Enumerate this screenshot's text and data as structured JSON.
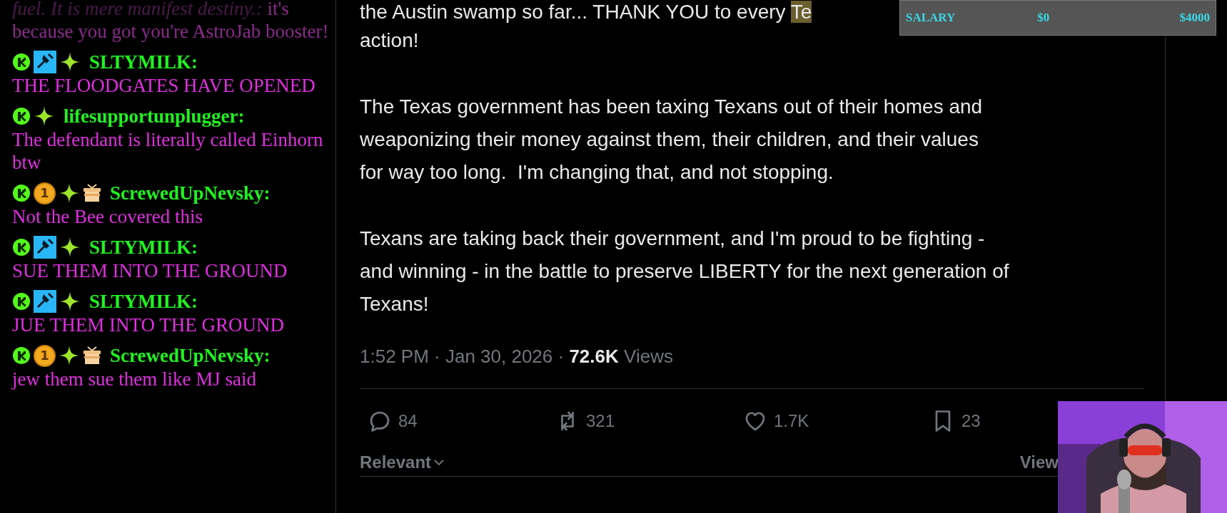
{
  "chat": {
    "messages": [
      {
        "faded": true,
        "prefix": "fuel. It is mere manifest destiny.:",
        "text": "it's because you got you're AstroJab booster!"
      },
      {
        "faded": false,
        "badges": [
          {
            "kind": "kick"
          },
          {
            "kind": "mod"
          },
          {
            "kind": "sparkle"
          }
        ],
        "user": "SLTYMILK:",
        "text": "THE FLOODGATES HAVE OPENED"
      },
      {
        "faded": false,
        "badges": [
          {
            "kind": "kick"
          },
          {
            "kind": "sparkle"
          }
        ],
        "user": "lifesupportunplugger:",
        "text": "The defendant is literally called Einhorn btw"
      },
      {
        "faded": false,
        "badges": [
          {
            "kind": "kick"
          },
          {
            "kind": "coin",
            "label": "1"
          },
          {
            "kind": "sparkle"
          },
          {
            "kind": "gift"
          }
        ],
        "user": "ScrewedUpNevsky:",
        "text": "Not the Bee covered this"
      },
      {
        "faded": false,
        "badges": [
          {
            "kind": "kick"
          },
          {
            "kind": "mod"
          },
          {
            "kind": "sparkle"
          }
        ],
        "user": "SLTYMILK:",
        "text": "SUE THEM INTO THE GROUND"
      },
      {
        "faded": false,
        "badges": [
          {
            "kind": "kick"
          },
          {
            "kind": "mod"
          },
          {
            "kind": "sparkle"
          }
        ],
        "user": "SLTYMILK:",
        "text": "JUE THEM INTO THE GROUND"
      },
      {
        "faded": false,
        "badges": [
          {
            "kind": "kick"
          },
          {
            "kind": "coin",
            "label": "1"
          },
          {
            "kind": "sparkle"
          },
          {
            "kind": "gift"
          }
        ],
        "user": "ScrewedUpNevsky:",
        "text": "jew them sue them like MJ said"
      }
    ]
  },
  "post": {
    "first_line": "the Austin swamp so far... THANK YOU to every",
    "highlighted": "Te",
    "paragraphs": [
      [
        "action!"
      ],
      [
        "The Texas government has been taxing Texans out of their homes and",
        "weaponizing their money against them, their children, and their values",
        "for way too long.  I'm changing that, and not stopping."
      ],
      [
        "Texans are taking back their government, and I'm proud to be fighting -",
        "and winning - in the battle to preserve LIBERTY for the next generation of",
        "Texans!"
      ]
    ],
    "timestamp": "1:52 PM · Jan 30, 2026 ·",
    "views_count": "72.6K",
    "views_label": "Views",
    "actions": [
      {
        "kind": "reply",
        "count": "84"
      },
      {
        "kind": "repost",
        "count": "321"
      },
      {
        "kind": "like",
        "count": "1.7K"
      },
      {
        "kind": "bookmark",
        "count": "23"
      }
    ],
    "sort": "Relevant",
    "view_link": "View"
  },
  "salary_overlay": {
    "label": "SALARY",
    "min": "$0",
    "max": "$4000"
  }
}
